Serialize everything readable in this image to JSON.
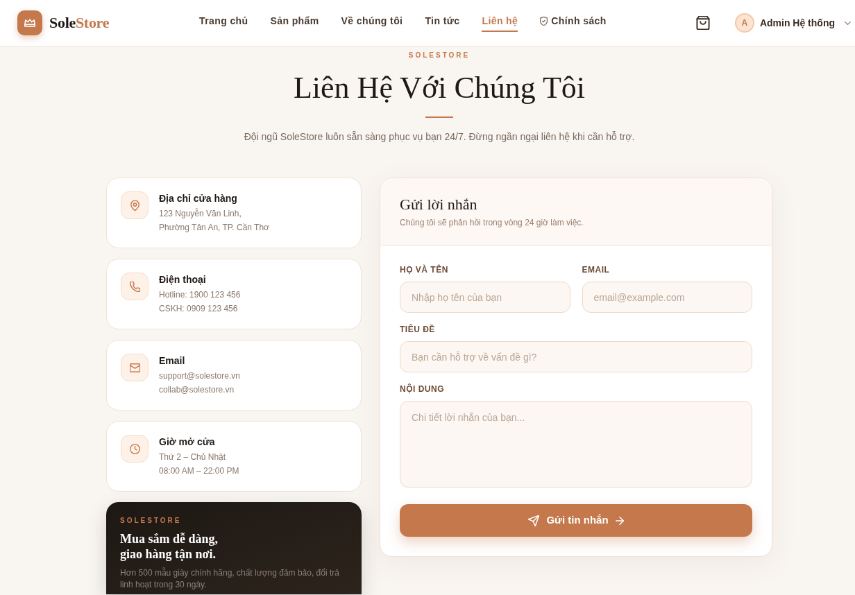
{
  "header": {
    "logo": {
      "name": "Sole",
      "accent": "Store"
    },
    "nav": [
      {
        "label": "Trang chủ",
        "selected": false,
        "kind": "plain"
      },
      {
        "label": "Sản phẩm",
        "selected": false,
        "kind": "plain"
      },
      {
        "label": "Về chúng tôi",
        "selected": false,
        "kind": "plain"
      },
      {
        "label": "Tin tức",
        "selected": false,
        "kind": "plain"
      },
      {
        "label": "Liên hệ",
        "selected": true,
        "kind": "plain"
      },
      {
        "label": "Chính sách",
        "selected": false,
        "kind": "shield"
      }
    ],
    "user": {
      "initial": "A",
      "name": "Admin Hệ thống"
    }
  },
  "hero": {
    "eyebrow": "SOLESTORE",
    "title": "Liên Hệ Với Chúng Tôi",
    "subtitle": "Đội ngũ SoleStore luôn sẵn sàng phục vụ bạn 24/7. Đừng ngần ngại liên hệ khi cần hỗ trợ."
  },
  "info_cards": [
    {
      "kind": "address",
      "title": "Địa chỉ cửa hàng",
      "lines": [
        "123 Nguyễn Văn Linh,",
        "Phường Tân An, TP. Cần Thơ"
      ]
    },
    {
      "kind": "phone",
      "title": "Điện thoại",
      "lines": [
        "Hotline: 1900 123 456",
        "CSKH: 0909 123 456"
      ]
    },
    {
      "kind": "email",
      "title": "Email",
      "lines": [
        "support@solestore.vn",
        "collab@solestore.vn"
      ]
    },
    {
      "kind": "hours",
      "title": "Giờ mở cửa",
      "lines": [
        "Thứ 2 – Chủ Nhật",
        "08:00 AM – 22:00 PM"
      ]
    }
  ],
  "promo": {
    "eyebrow": "SOLESTORE",
    "heading_lines": [
      "Mua sắm dễ dàng,",
      "giao hàng tận nơi."
    ],
    "text": "Hơn 500 mẫu giày chính hãng, chất lượng đảm bảo, đổi trả linh hoạt trong 30 ngày."
  },
  "form": {
    "title": "Gửi lời nhắn",
    "subtitle": "Chúng tôi sẽ phản hồi trong vòng 24 giờ làm việc.",
    "fields": [
      {
        "kind": "half",
        "label": "HỌ VÀ TÊN",
        "placeholder": "Nhập họ tên của bạn"
      },
      {
        "kind": "half",
        "label": "EMAIL",
        "placeholder": "email@example.com"
      },
      {
        "kind": "full",
        "label": "TIÊU ĐỀ",
        "placeholder": "Bạn cần hỗ trợ về vấn đề gì?"
      },
      {
        "kind": "area",
        "label": "NỘI DUNG",
        "placeholder": "Chi tiết lời nhắn của bạn..."
      }
    ],
    "submit": "Gửi tin nhắn"
  }
}
